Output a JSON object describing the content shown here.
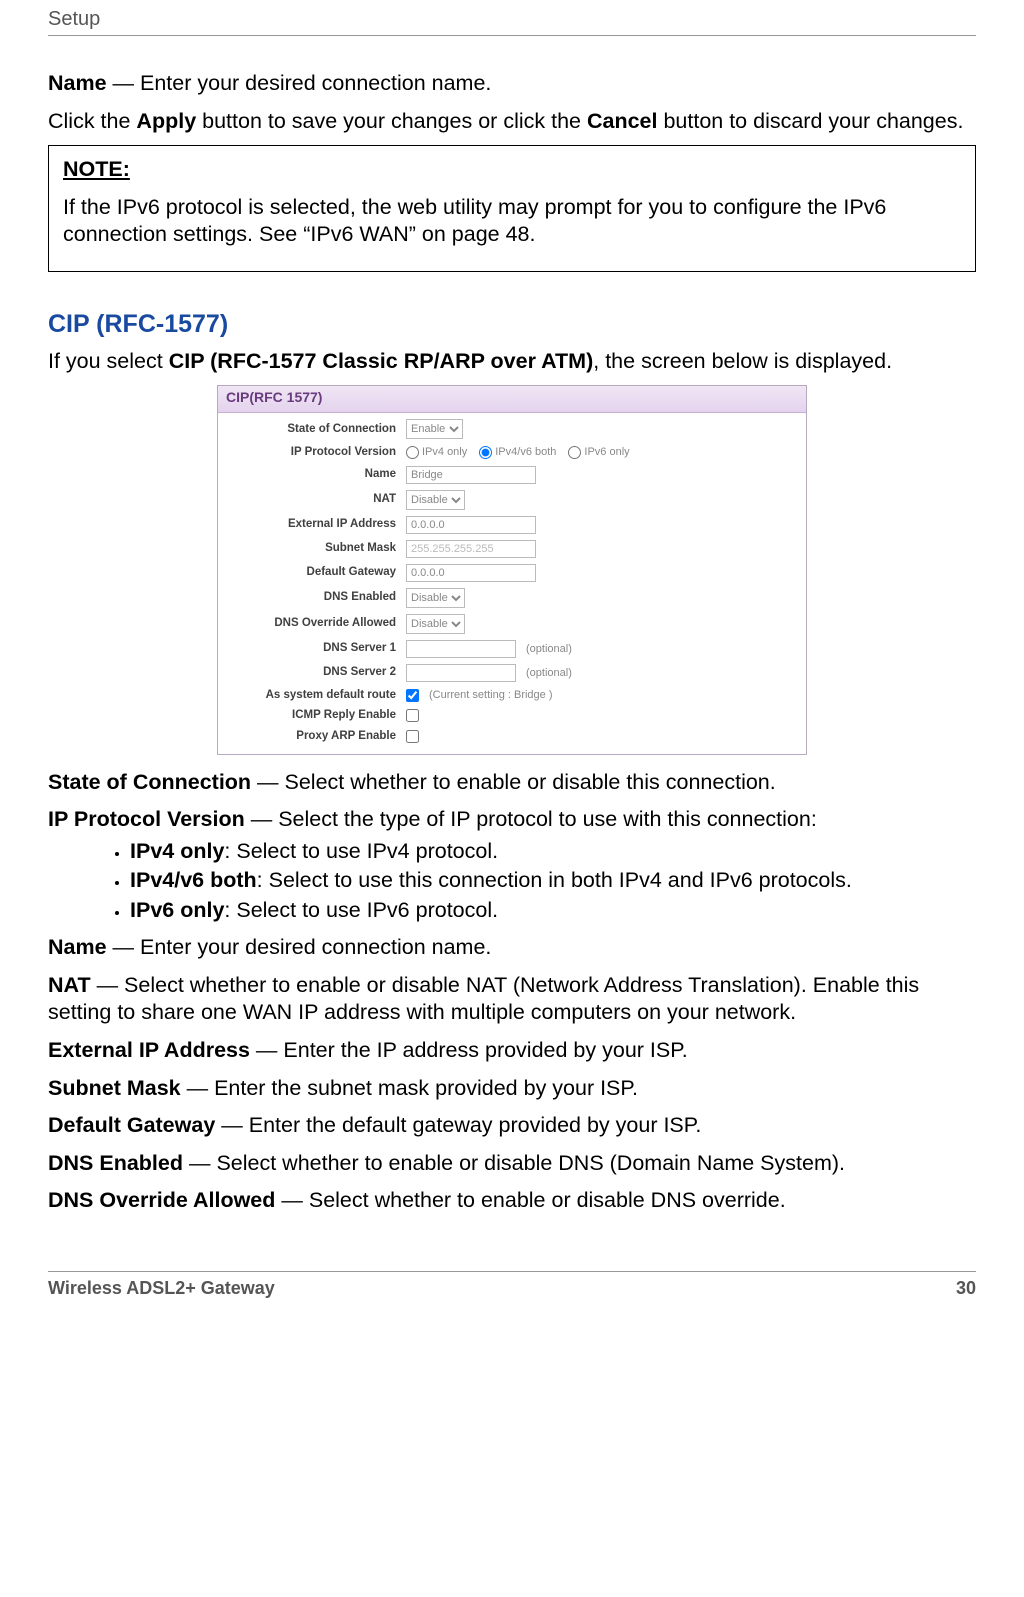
{
  "header": {
    "title": "Setup"
  },
  "intro": {
    "name_label": "Name",
    "name_desc": " — Enter your desired connection name.",
    "apply_line_1": "Click the ",
    "apply_bold": "Apply",
    "apply_line_2": " button to save your changes or click the ",
    "cancel_bold": "Cancel",
    "apply_line_3": " button to discard your changes."
  },
  "note": {
    "label": "NOTE:",
    "text": "If the IPv6 protocol is selected, the web utility may prompt for you to configure the IPv6 connection settings. See “IPv6 WAN” on page 48."
  },
  "section": {
    "heading": "CIP (RFC-1577)",
    "lead_1": "If you select ",
    "lead_bold": "CIP (RFC-1577 Classic RP/ARP over ATM)",
    "lead_2": ", the screen below is displayed."
  },
  "form": {
    "panel_title": "CIP(RFC 1577)",
    "rows": {
      "state": {
        "label": "State of Connection",
        "value": "Enable"
      },
      "ipproto": {
        "label": "IP Protocol Version",
        "opts": {
          "v4": "IPv4 only",
          "both": "IPv4/v6 both",
          "v6": "IPv6 only"
        }
      },
      "name": {
        "label": "Name",
        "value": "Bridge"
      },
      "nat": {
        "label": "NAT",
        "value": "Disable"
      },
      "extip": {
        "label": "External IP Address",
        "value": "0.0.0.0"
      },
      "mask": {
        "label": "Subnet Mask",
        "value": "255.255.255.255"
      },
      "gw": {
        "label": "Default Gateway",
        "value": "0.0.0.0"
      },
      "dnsen": {
        "label": "DNS Enabled",
        "value": "Disable"
      },
      "dnsov": {
        "label": "DNS Override Allowed",
        "value": "Disable"
      },
      "dns1": {
        "label": "DNS Server 1",
        "hint": "(optional)"
      },
      "dns2": {
        "label": "DNS Server 2",
        "hint": "(optional)"
      },
      "defroute": {
        "label": "As system default route",
        "hint": "(Current setting : Bridge )"
      },
      "icmp": {
        "label": "ICMP Reply Enable"
      },
      "arp": {
        "label": "Proxy ARP Enable"
      }
    }
  },
  "defs": {
    "state": {
      "term": "State of Connection",
      "desc": " — Select whether to enable or disable this connection."
    },
    "ipproto": {
      "term": "IP Protocol Version",
      "desc": " — Select the type of IP protocol to use with this connection:"
    },
    "bullets": {
      "v4": {
        "term": "IPv4 only",
        "desc": ": Select to use IPv4 protocol."
      },
      "both": {
        "term": "IPv4/v6 both",
        "desc": ": Select to use this connection in both IPv4 and IPv6 protocols."
      },
      "v6": {
        "term": "IPv6 only",
        "desc": ": Select to use IPv6 protocol."
      }
    },
    "name": {
      "term": "Name",
      "desc": " — Enter your desired connection name."
    },
    "nat": {
      "term": "NAT",
      "desc": " — Select whether to enable or disable NAT (Network Address Translation). Enable this setting to share one WAN IP address with multiple computers on your network."
    },
    "extip": {
      "term": "External IP Address",
      "desc": " — Enter the IP address provided by your ISP."
    },
    "mask": {
      "term": "Subnet Mask",
      "desc": " — Enter the subnet mask provided by your ISP."
    },
    "gw": {
      "term": "Default Gateway",
      "desc": " — Enter the default gateway provided by your ISP."
    },
    "dnsen": {
      "term": "DNS Enabled",
      "desc": " — Select whether to enable or disable DNS (Domain Name System)."
    },
    "dnsov": {
      "term": "DNS Override Allowed",
      "desc": " — Select whether to enable or disable DNS override."
    }
  },
  "footer": {
    "product": "Wireless ADSL2+ Gateway",
    "page": "30"
  }
}
